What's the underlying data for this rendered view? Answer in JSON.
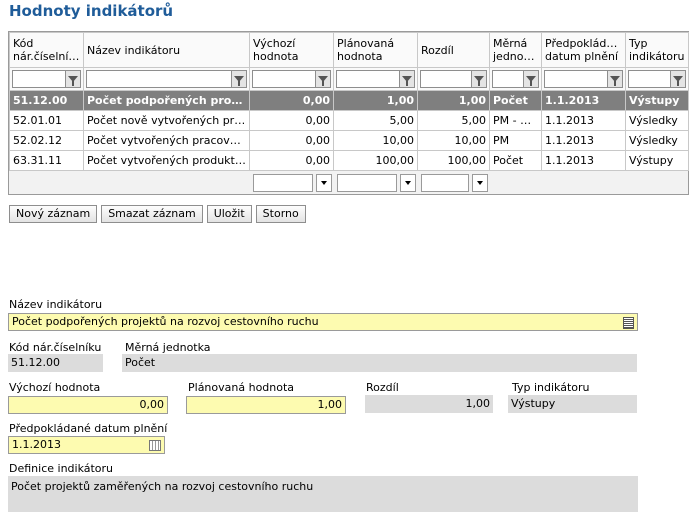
{
  "page_title": "Hodnoty indikátorů",
  "grid": {
    "headers": [
      "Kód nár.číselníku",
      "Název indikátoru",
      "Výchozí hodnota",
      "Plánovaná hodnota",
      "Rozdíl",
      "Měrná jednotka",
      "Předpokládané datum plnění",
      "Typ indikátoru"
    ],
    "rows": [
      [
        "51.12.00",
        "Počet podpořených projektů …",
        "0,00",
        "1,00",
        "1,00",
        "Počet",
        "1.1.2013",
        "Výstupy"
      ],
      [
        "52.01.01",
        "Počet nově vytvořených prac…",
        "0,00",
        "5,00",
        "5,00",
        "PM - m…",
        "1.1.2013",
        "Výsledky"
      ],
      [
        "52.02.12",
        "Počet vytvořených pracovních…",
        "0,00",
        "10,00",
        "10,00",
        "PM",
        "1.1.2013",
        "Výsledky"
      ],
      [
        "63.31.11",
        "Počet vytvořených produktů …",
        "0,00",
        "100,00",
        "100,00",
        "Počet",
        "1.1.2013",
        "Výstupy"
      ]
    ]
  },
  "buttons": {
    "new": "Nový záznam",
    "delete": "Smazat záznam",
    "save": "Uložit",
    "cancel": "Storno"
  },
  "detail": {
    "name_label": "Název indikátoru",
    "name_value": "Počet podpořených projektů na rozvoj cestovního ruchu",
    "code_label": "Kód nár.číselníku",
    "code_value": "51.12.00",
    "unit_label": "Měrná jednotka",
    "unit_value": "Počet",
    "initial_label": "Výchozí hodnota",
    "initial_value": "0,00",
    "planned_label": "Plánovaná hodnota",
    "planned_value": "1,00",
    "diff_label": "Rozdíl",
    "diff_value": "1,00",
    "type_label": "Typ indikátoru",
    "type_value": "Výstupy",
    "date_label": "Předpokládané datum plnění",
    "date_value": "1.1.2013",
    "definition_label": "Definice indikátoru",
    "definition_value": "Počet projektů zaměřených na rozvoj cestovního ruchu"
  }
}
